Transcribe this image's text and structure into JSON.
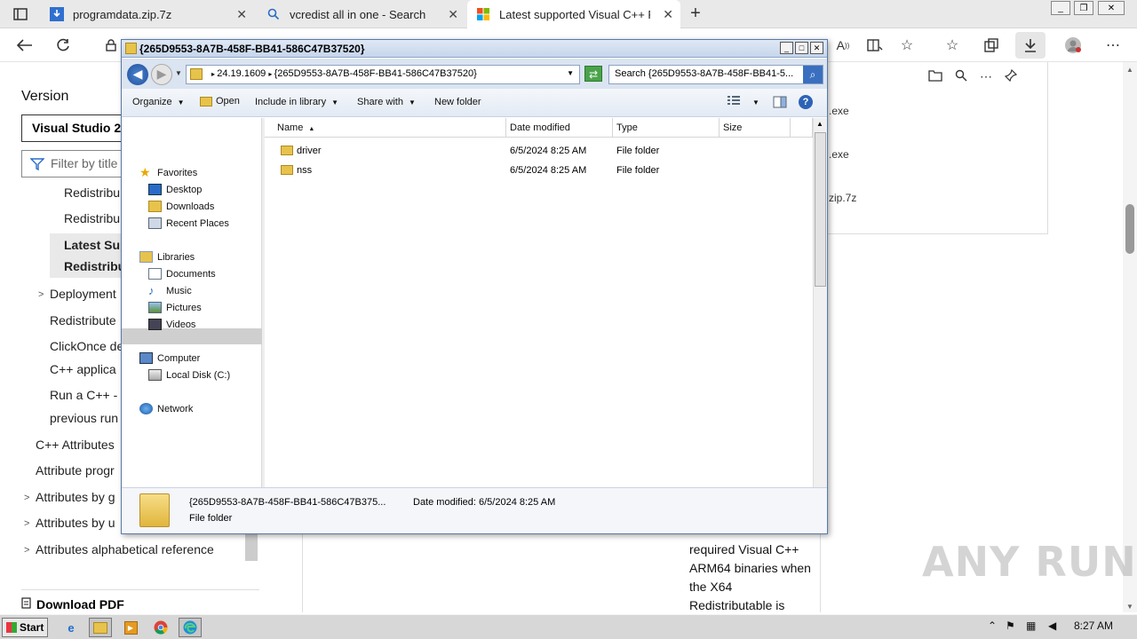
{
  "browser": {
    "tabs": [
      {
        "title": "programdata.zip.7z",
        "active": false
      },
      {
        "title": "vcredist all in one - Search",
        "active": false
      },
      {
        "title": "Latest supported Visual C++ Red",
        "active": true
      }
    ],
    "new_tab_symbol": "+",
    "close_symbol": "✕"
  },
  "page": {
    "version_heading": "Version",
    "version_value": "Visual Studio 20",
    "filter_placeholder": "Filter by title",
    "nav_items": [
      "Redistribu",
      "Redistribu",
      "Latest Sup",
      "Redistribu",
      "Deployment",
      "Redistribute",
      "ClickOnce de",
      "C++ applica",
      "Run a C++ -",
      "previous run",
      "C++ Attributes",
      "Attribute progr",
      "Attributes by g",
      "Attributes by u",
      "Attributes alphabetical reference"
    ],
    "download_pdf": "Download PDF",
    "main_text": "required Visual C++ ARM64 binaries when the X64 Redistributable is",
    "downloads": [
      ".exe",
      ".exe",
      "zip.7z"
    ],
    "watermark": "ANY RUN"
  },
  "explorer": {
    "title": "{265D9553-8A7B-458F-BB41-586C47B37520}",
    "address_parts": [
      "24.19.1609",
      "{265D9553-8A7B-458F-BB41-586C47B37520}"
    ],
    "search_placeholder": "Search {265D9553-8A7B-458F-BB41-5...",
    "commands": {
      "organize": "Organize",
      "open": "Open",
      "include": "Include in library",
      "share": "Share with",
      "new_folder": "New folder"
    },
    "nav": {
      "favorites": "Favorites",
      "desktop": "Desktop",
      "downloads": "Downloads",
      "recent": "Recent Places",
      "libraries": "Libraries",
      "documents": "Documents",
      "music": "Music",
      "pictures": "Pictures",
      "videos": "Videos",
      "computer": "Computer",
      "local_disk": "Local Disk (C:)",
      "network": "Network"
    },
    "columns": {
      "name": "Name",
      "date": "Date modified",
      "type": "Type",
      "size": "Size"
    },
    "rows": [
      {
        "name": "driver",
        "date": "6/5/2024 8:25 AM",
        "type": "File folder",
        "size": ""
      },
      {
        "name": "nss",
        "date": "6/5/2024 8:25 AM",
        "type": "File folder",
        "size": ""
      }
    ],
    "details": {
      "name": "{265D9553-8A7B-458F-BB41-586C47B375...",
      "modified_label": "Date modified:",
      "modified_value": "6/5/2024 8:25 AM",
      "type": "File folder"
    }
  },
  "taskbar": {
    "start": "Start",
    "time": "8:27 AM"
  },
  "colors": {
    "explorer_border": "#5a7aa8",
    "folder": "#e8c34b",
    "taskbar": "#d7d7d7"
  }
}
